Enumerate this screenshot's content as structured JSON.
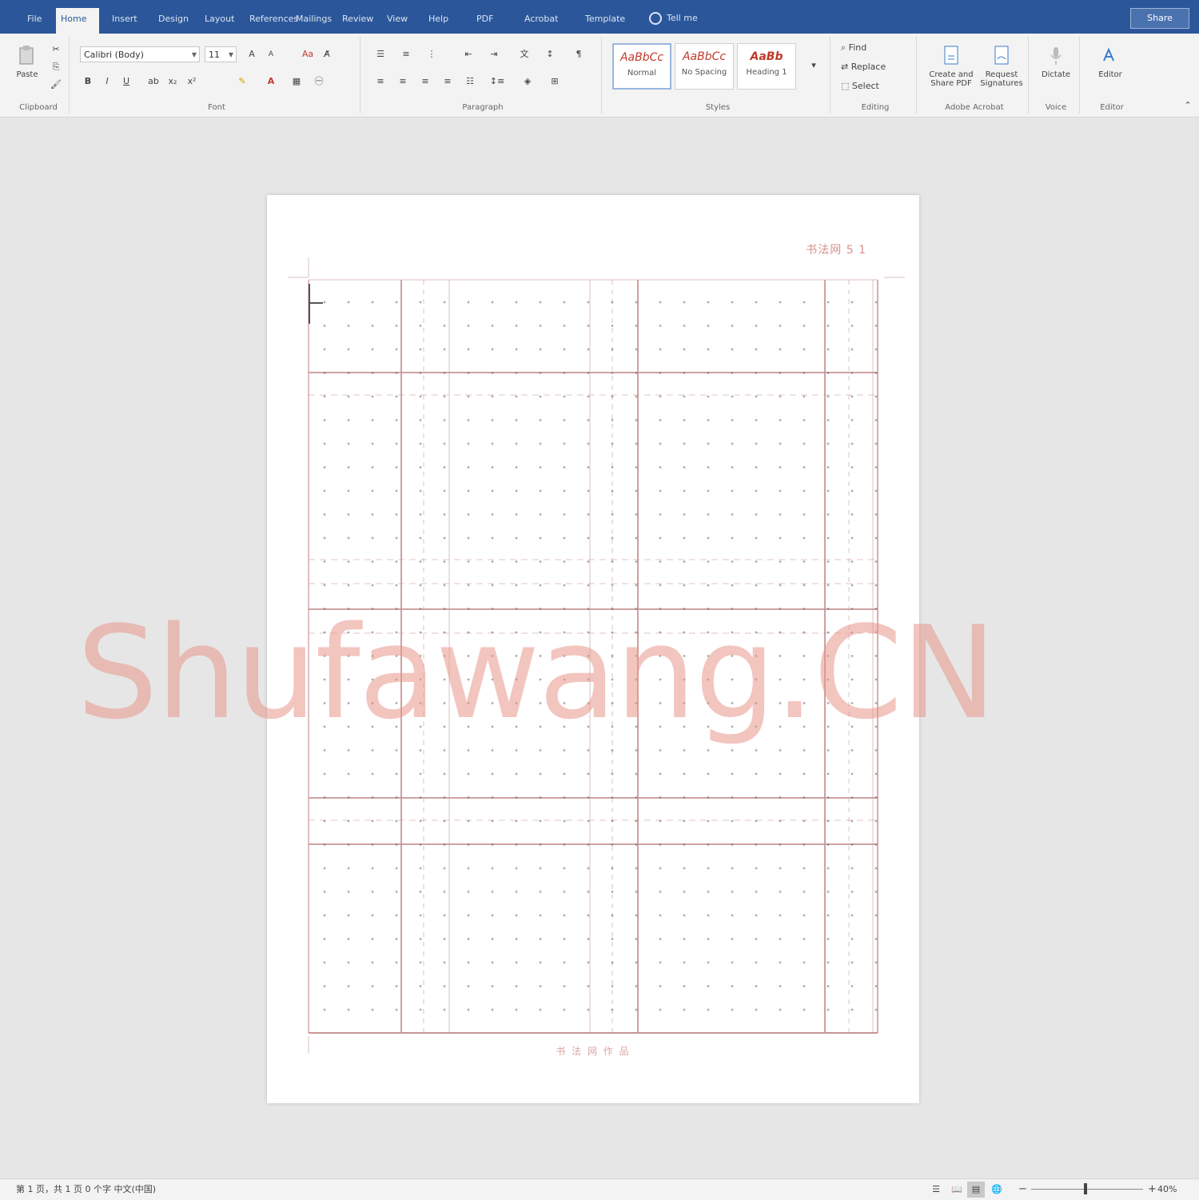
{
  "tabs": [
    {
      "label": "File"
    },
    {
      "label": "Home"
    },
    {
      "label": "Insert"
    },
    {
      "label": "Design"
    },
    {
      "label": "Layout"
    },
    {
      "label": "References"
    },
    {
      "label": "Mailings"
    },
    {
      "label": "Review"
    },
    {
      "label": "View"
    },
    {
      "label": "Help"
    },
    {
      "label": "PDF"
    },
    {
      "label": "Acrobat"
    },
    {
      "label": "Template"
    }
  ],
  "tell_me": "Tell me",
  "share": "Share",
  "ribbon": {
    "clipboard": {
      "label": "Clipboard",
      "paste": "Paste"
    },
    "font": {
      "label": "Font",
      "font_name": "Calibri (Body)",
      "font_size": "11",
      "bold": "B",
      "italic": "I",
      "underline": "U"
    },
    "paragraph": {
      "label": "Paragraph"
    },
    "styles": {
      "label": "Styles",
      "items": [
        {
          "sample": "AaBbCc",
          "name": "Normal"
        },
        {
          "sample": "AaBbCc",
          "name": "No Spacing"
        },
        {
          "sample": "AaBb",
          "name": "Heading 1"
        }
      ]
    },
    "editing": {
      "label": "Editing",
      "find": "Find",
      "replace": "Replace",
      "select": "Select"
    },
    "acrobat": {
      "label": "Adobe Acrobat",
      "create_pdf": "Create and Share PDF",
      "request_sig": "Request Signatures"
    },
    "voice": {
      "label": "Voice",
      "dictate": "Dictate"
    },
    "editor": {
      "label": "Editor",
      "editor_btn": "Editor"
    }
  },
  "document": {
    "header_text": "书法网 5 1",
    "footer_text": "书 法 网 作 品",
    "watermark": "Shufawang.CN"
  },
  "status": {
    "text": "第 1 页，共 1 页 0 个字 中文(中国)",
    "zoom": "40%"
  },
  "colors": {
    "title_bar": "#2b579a",
    "grid_line": "#c89696",
    "watermark": "#e8968a"
  }
}
